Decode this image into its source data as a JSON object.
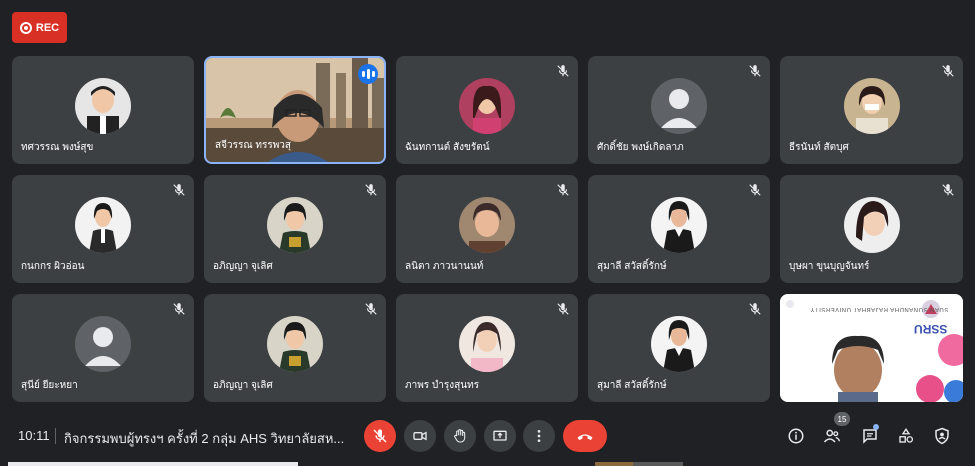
{
  "rec_label": "REC",
  "participants": [
    {
      "name": "ทศวรรณ พงษ์สุข"
    },
    {
      "name": "สจีวรรณ ทรรพวสุ"
    },
    {
      "name": "ฉันทกานต์ สังขรัตน์"
    },
    {
      "name": "ศักดิ์ชัย พงษ์เกิดลาภ"
    },
    {
      "name": "ธีรนันท์ สัตบุศ"
    },
    {
      "name": "กนกกร ผิวอ่อน"
    },
    {
      "name": "อภิญญา จุเลิศ"
    },
    {
      "name": "ลนิตา ภาวนานนท์"
    },
    {
      "name": "สุมาลี สวัสดิ์รักษ์"
    },
    {
      "name": "บุษผา ขุนบุญจันทร์"
    },
    {
      "name": "สุนีย์ ยียะหยา"
    },
    {
      "name": "อภิญญา จุเลิศ"
    },
    {
      "name": "ภาพร บำรุงสุนทร"
    },
    {
      "name": "สุมาลี สวัสดิ์รักษ์"
    }
  ],
  "screen_share": {
    "banner": "SUAN SUNANDHA RAJABHAT UNIVERSITY",
    "logo": "SSRU"
  },
  "bottom": {
    "time": "10:11",
    "meeting_title": "กิจกรรมพบผู้ทรงฯ ครั้งที่ 2 กลุ่ม AHS วิทยาลัยสห...",
    "people_count": "15"
  },
  "colors": {
    "rec": "#d93025",
    "active_border": "#8ab4f8",
    "speak": "#1a73e8",
    "end_call": "#ea4335",
    "mic_off": "#ea4335"
  },
  "icons": [
    "mic-off-icon",
    "camera-icon",
    "raise-hand-icon",
    "present-icon",
    "more-icon",
    "end-call-icon",
    "info-icon",
    "people-icon",
    "chat-icon",
    "activities-icon",
    "host-controls-icon"
  ]
}
